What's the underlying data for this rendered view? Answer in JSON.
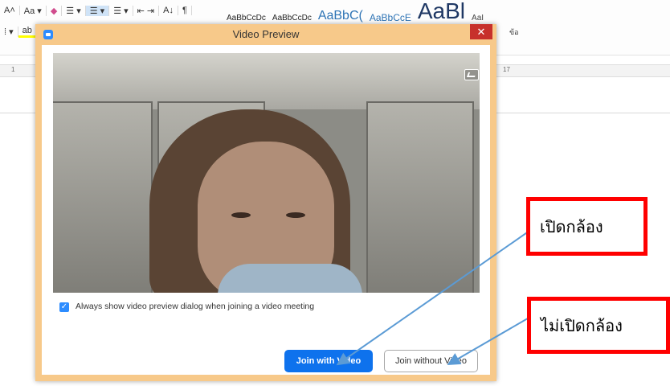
{
  "ribbon": {
    "row1": [
      "A˄",
      "Aa ▾",
      "",
      "☰ ▾",
      "☰ ▾",
      "☰ ▾",
      "⇤ ⇥",
      "A↓",
      "¶"
    ],
    "row2": [
      "⁞ ▾",
      "ab"
    ],
    "styles": [
      "AaBbCcDc",
      "AaBbCcDc",
      "AaBbC(",
      "AaBbCcE",
      "AaBl",
      "AaI"
    ],
    "thai_small": "ข้อ",
    "ruler_left": "1",
    "ruler_right": "17"
  },
  "dialog": {
    "title": "Video Preview",
    "close_label": "✕",
    "checkbox_checked": true,
    "checkbox_label": "Always show video preview dialog when joining a video meeting",
    "join_with_video": "Join with Video",
    "join_without_video": "Join without Video",
    "icons": {
      "app": "zoom-app-icon",
      "photo": "photo-icon",
      "close": "close-icon"
    },
    "colors": {
      "accent": "#0e72ed",
      "frame": "#f7c98a",
      "close": "#c7302b"
    }
  },
  "annotations": {
    "open_camera": "เปิดกล้อง",
    "no_camera": "ไม่เปิดกล้อง",
    "colors": {
      "box": "#ff0000",
      "arrow": "#5b9bd5"
    }
  }
}
